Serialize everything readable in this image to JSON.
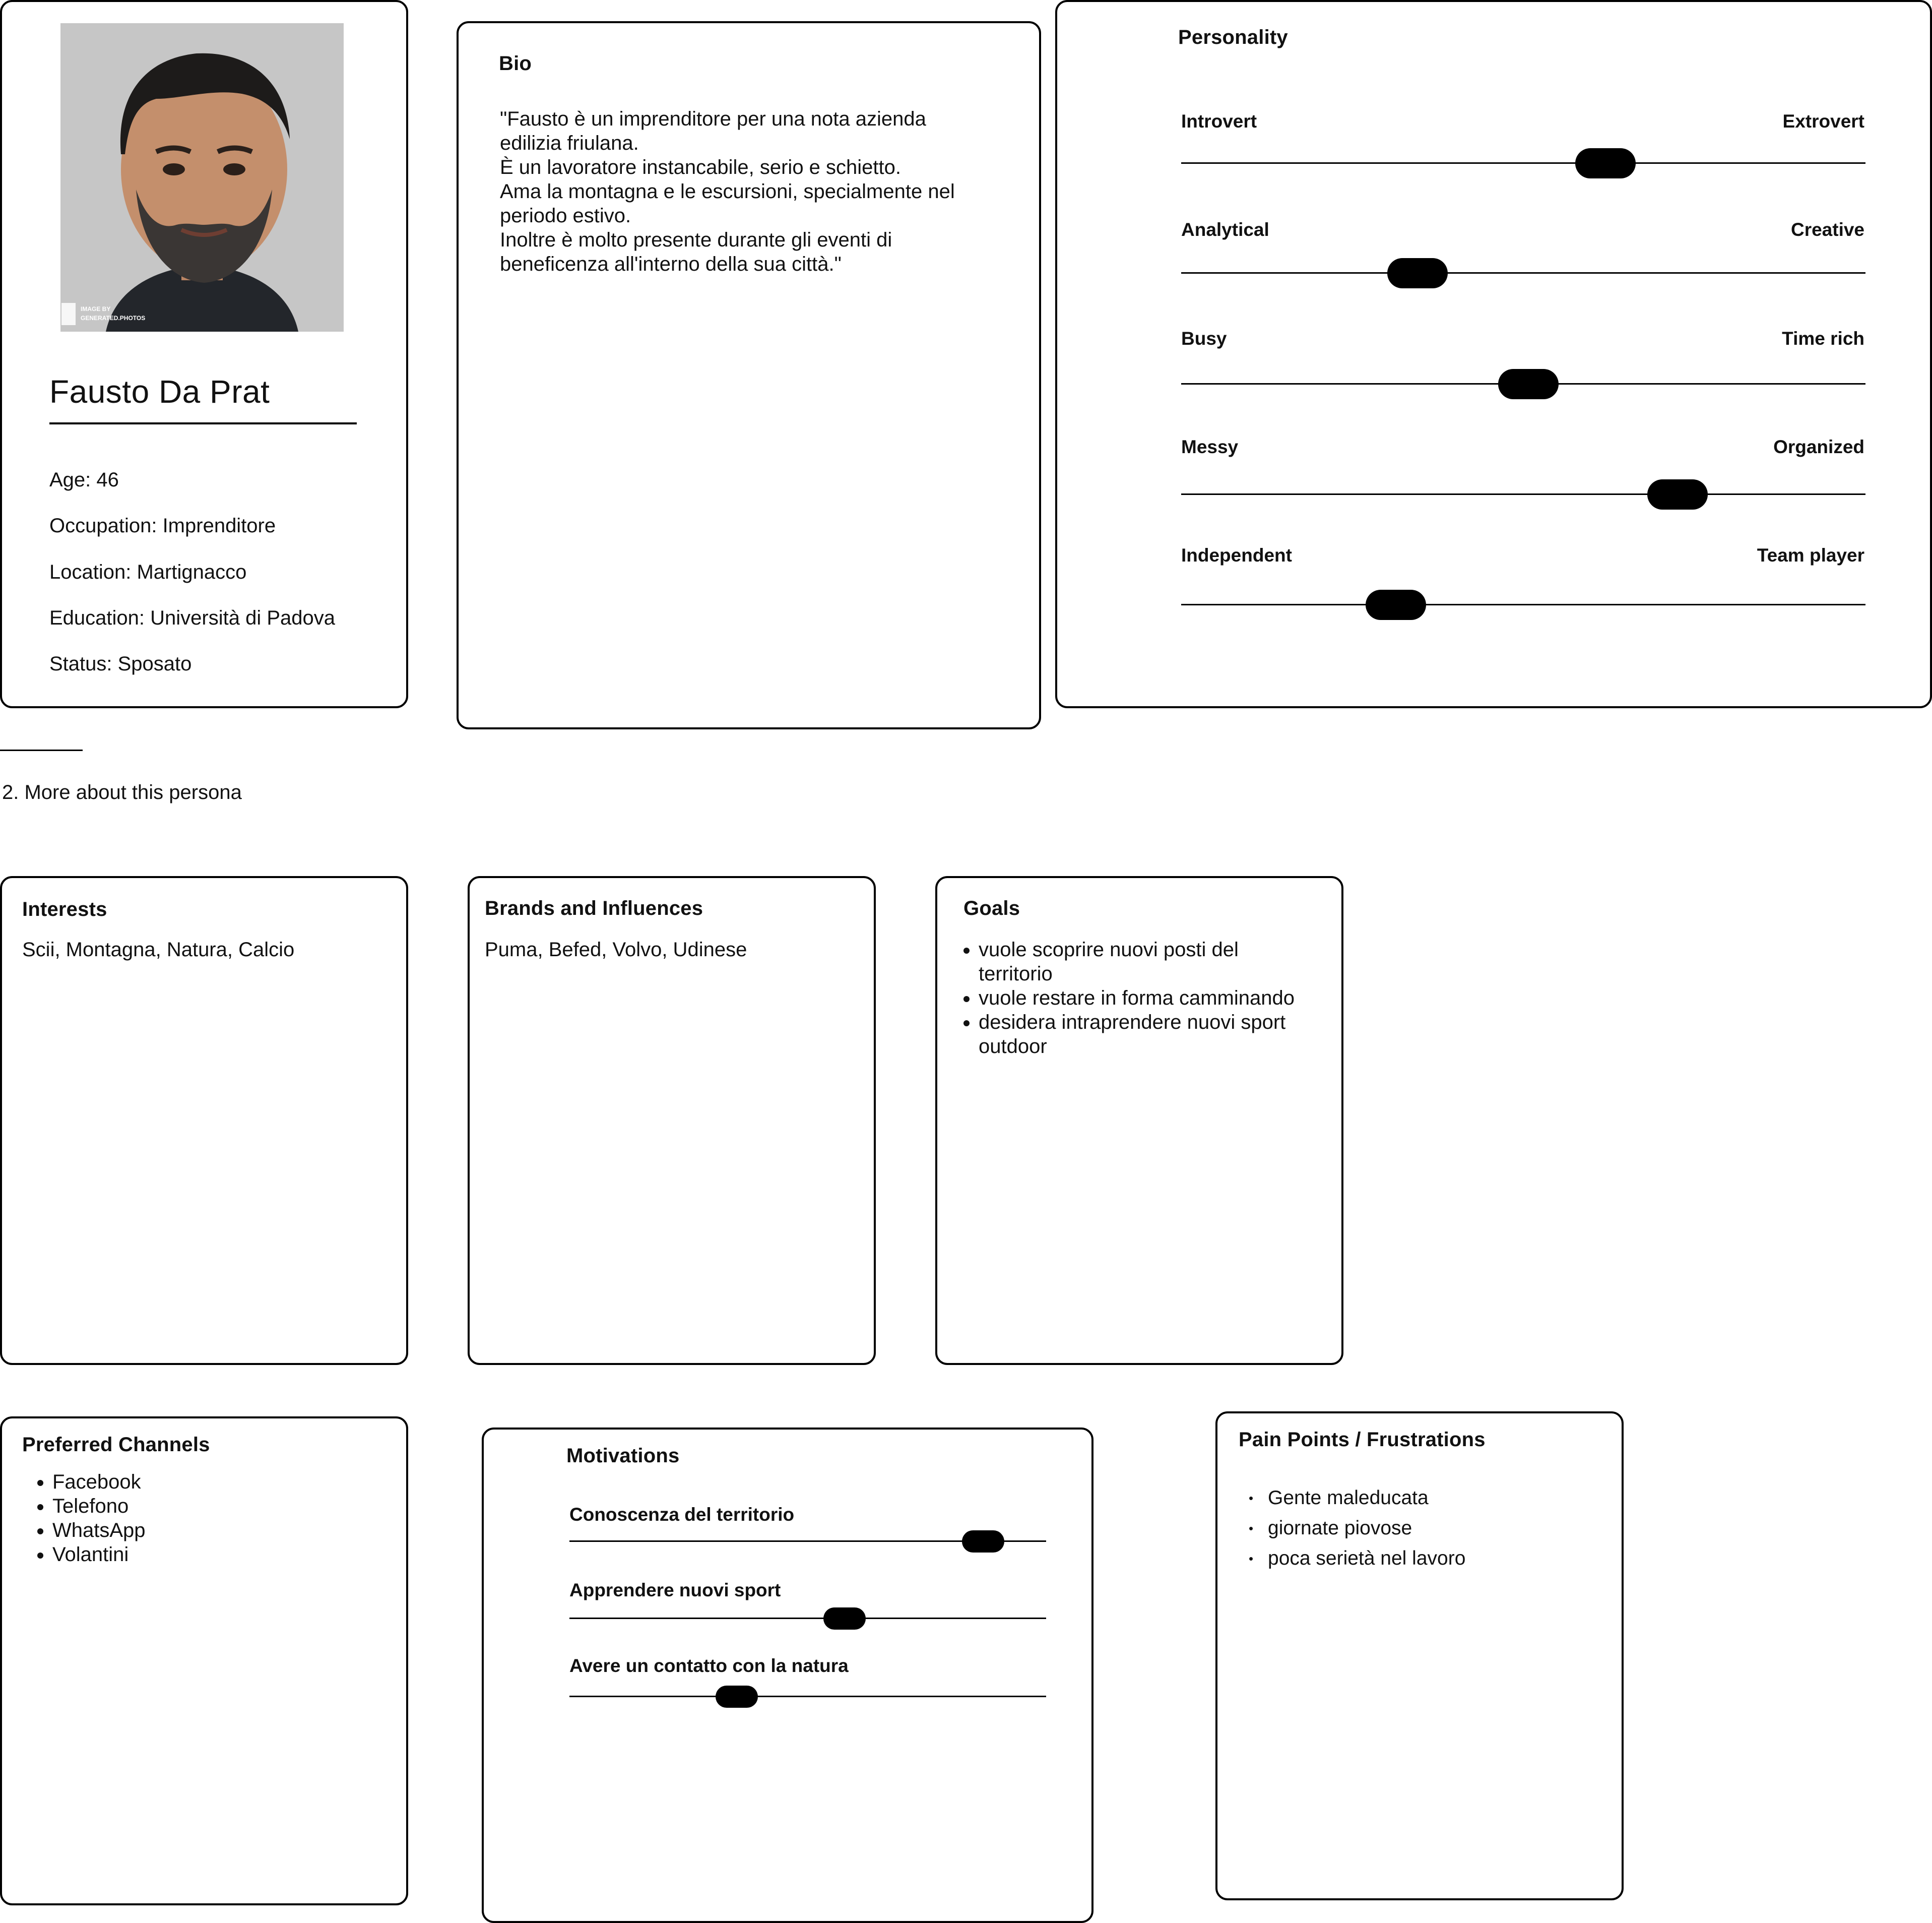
{
  "profile": {
    "name": "Fausto Da Prat",
    "photo_watermark_line1": "IMAGE BY",
    "photo_watermark_line2": "GENERATED.PHOTOS",
    "fields": [
      "Age: 46",
      "Occupation: Imprenditore",
      "Location: Martignacco",
      "Education: Università di Padova",
      "Status: Sposato"
    ]
  },
  "bio": {
    "title": "Bio",
    "lines": [
      "\"Fausto è un imprenditore per una nota azienda",
      "edilizia friulana.",
      "È un lavoratore instancabile, serio e schietto.",
      "Ama la montagna e le escursioni, specialmente nel",
      "periodo estivo.",
      "Inoltre è molto presente durante gli eventi di",
      "beneficenza all'interno della sua città.\""
    ]
  },
  "personality": {
    "title": "Personality",
    "traits": [
      {
        "left": "Introvert",
        "right": "Extrovert",
        "value": 0.62
      },
      {
        "left": "Analytical",
        "right": "Creative",
        "value": 0.345
      },
      {
        "left": "Busy",
        "right": "Time rich",
        "value": 0.507
      },
      {
        "left": "Messy",
        "right": "Organized",
        "value": 0.725
      },
      {
        "left": "Independent",
        "right": "Team player",
        "value": 0.314
      }
    ]
  },
  "section": {
    "heading": "2. More about this persona"
  },
  "interests": {
    "title": "Interests",
    "text": "Scii, Montagna, Natura, Calcio"
  },
  "brands": {
    "title": "Brands and Influences",
    "text": "Puma, Befed, Volvo, Udinese"
  },
  "goals": {
    "title": "Goals",
    "items": [
      [
        "vuole scoprire nuovi posti del",
        "territorio"
      ],
      [
        "vuole restare in forma camminando"
      ],
      [
        "desidera intraprendere nuovi sport",
        "outdoor"
      ]
    ]
  },
  "channels": {
    "title": "Preferred Channels",
    "items": [
      "Facebook",
      "Telefono",
      "WhatsApp",
      "Volantini"
    ]
  },
  "motivations": {
    "title": "Motivations",
    "items": [
      {
        "label": "Conoscenza del territorio",
        "value": 0.868
      },
      {
        "label": "Apprendere nuovi sport",
        "value": 0.577
      },
      {
        "label": "Avere un contatto con la natura",
        "value": 0.351
      }
    ]
  },
  "pain_points": {
    "title": "Pain Points / Frustrations",
    "items": [
      "Gente maleducata",
      "giornate piovose",
      "poca serietà nel lavoro"
    ]
  }
}
